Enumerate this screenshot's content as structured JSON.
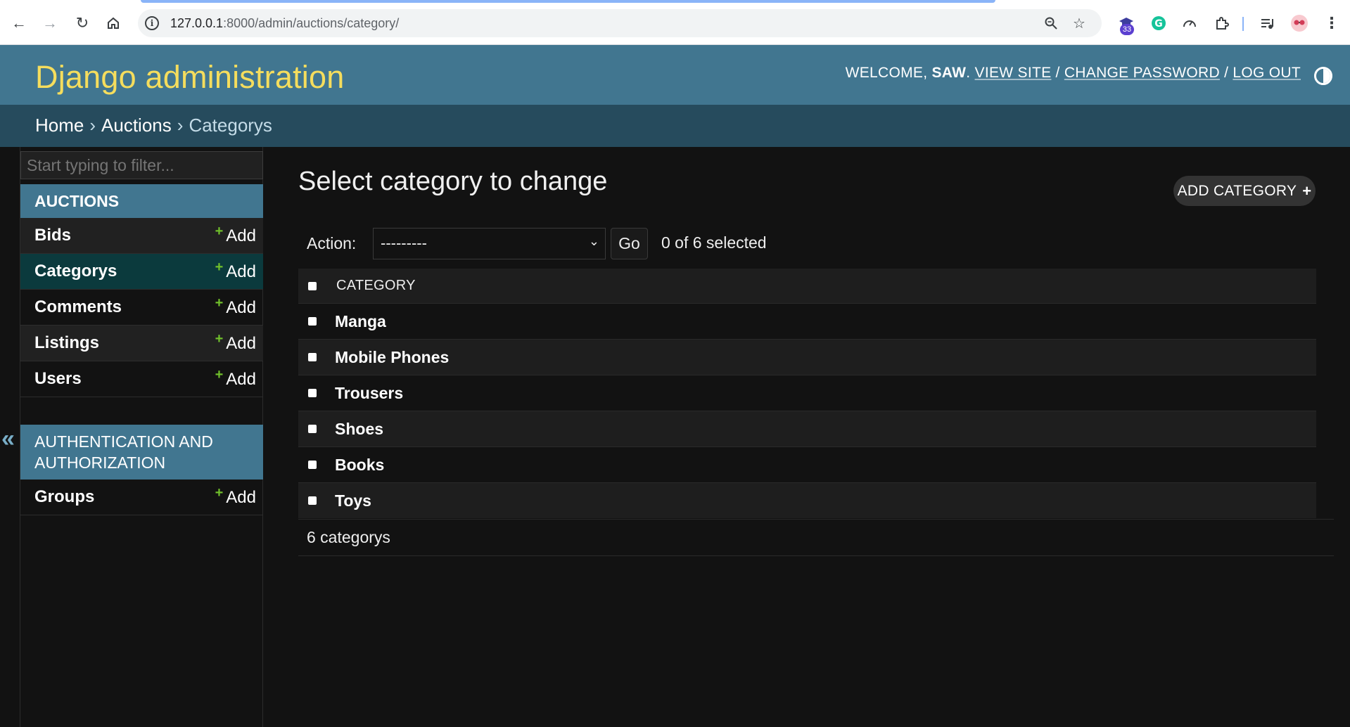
{
  "browser": {
    "url_host": "127.0.0.1",
    "url_rest": ":8000/admin/auctions/category/",
    "extension_badge": "33"
  },
  "header": {
    "site_name": "Django administration",
    "welcome": "WELCOME, ",
    "username": "SAW",
    "after_user": ". ",
    "view_site": "VIEW SITE",
    "sep": " / ",
    "change_password": "CHANGE PASSWORD",
    "log_out": "LOG OUT"
  },
  "breadcrumbs": {
    "home": "Home",
    "app": "Auctions",
    "current": "Categorys",
    "sep": "›"
  },
  "sidebar": {
    "filter_placeholder": "Start typing to filter...",
    "add_label": "Add",
    "plus": "+",
    "collapse": "«",
    "apps": [
      {
        "name": "AUCTIONS",
        "models": [
          "Bids",
          "Categorys",
          "Comments",
          "Listings",
          "Users"
        ]
      },
      {
        "name_line1": "AUTHENTICATION AND",
        "name_line2": "AUTHORIZATION",
        "models": [
          "Groups"
        ]
      }
    ]
  },
  "content": {
    "title": "Select category to change",
    "add_button": "ADD CATEGORY",
    "add_plus": "+",
    "action_label": "Action:",
    "action_selected": "---------",
    "go": "Go",
    "counter": "0 of 6 selected",
    "column_header": "CATEGORY",
    "rows": [
      "Manga",
      "Mobile Phones",
      "Trousers",
      "Shoes",
      "Books",
      "Toys"
    ],
    "paginator": "6 categorys"
  }
}
